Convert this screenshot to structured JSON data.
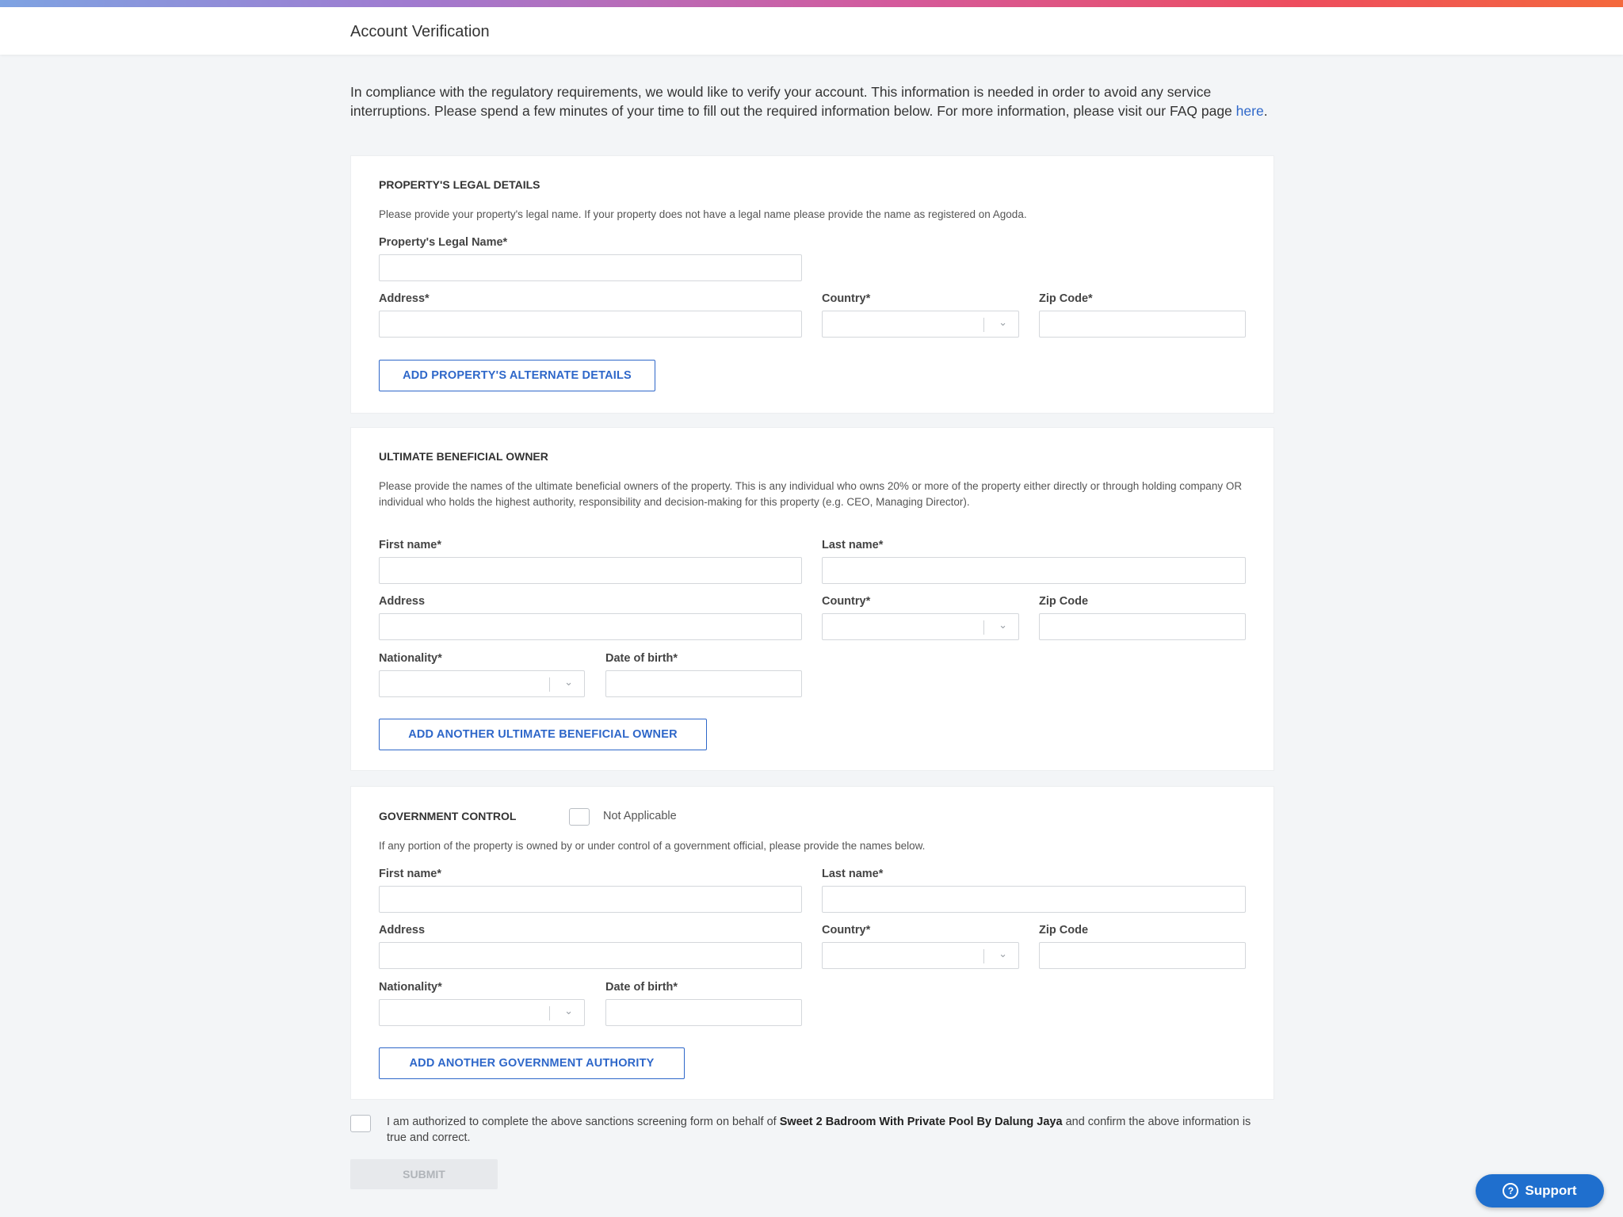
{
  "header": {
    "title": "Account Verification"
  },
  "intro": {
    "text": "In compliance with the regulatory requirements, we would like to verify your account. This information is needed in order to avoid any service interruptions. Please spend a few minutes of your time to fill out the required information below. For more information, please visit our FAQ page ",
    "link": "here",
    "end": "."
  },
  "legal": {
    "title": "PROPERTY'S LEGAL DETAILS",
    "desc": "Please provide your property's legal name. If your property does not have a legal name please provide the name as registered on Agoda.",
    "legal_name_label": "Property's Legal Name*",
    "address_label": "Address*",
    "country_label": "Country*",
    "zip_label": "Zip Code*",
    "button": "ADD PROPERTY'S ALTERNATE DETAILS"
  },
  "ubo": {
    "title": "ULTIMATE BENEFICIAL OWNER",
    "desc": "Please provide the names of the ultimate beneficial owners of the property. This is any individual who owns 20% or more of the property either directly or through holding company OR individual who holds the highest authority, responsibility and decision-making for this property (e.g. CEO, Managing Director).",
    "first_name_label": "First name*",
    "last_name_label": "Last name*",
    "address_label": "Address",
    "country_label": "Country*",
    "zip_label": "Zip Code",
    "nationality_label": "Nationality*",
    "dob_label": "Date of birth*",
    "button": "ADD ANOTHER ULTIMATE BENEFICIAL OWNER"
  },
  "gov": {
    "title": "GOVERNMENT CONTROL",
    "not_applicable": "Not Applicable",
    "desc": "If any portion of the property is owned by or under control of a government official, please provide the names below.",
    "first_name_label": "First name*",
    "last_name_label": "Last name*",
    "address_label": "Address",
    "country_label": "Country*",
    "zip_label": "Zip Code",
    "nationality_label": "Nationality*",
    "dob_label": "Date of birth*",
    "button": "ADD ANOTHER GOVERNMENT AUTHORITY"
  },
  "consent": {
    "pre": "I am authorized to complete the above sanctions screening form on behalf of ",
    "property": "Sweet 2 Badroom With Private Pool By Dalung Jaya",
    "post": " and confirm the above information is true and correct."
  },
  "submit_label": "SUBMIT",
  "support_label": "Support",
  "icons": {
    "chevron": "⌄",
    "question": "?"
  }
}
